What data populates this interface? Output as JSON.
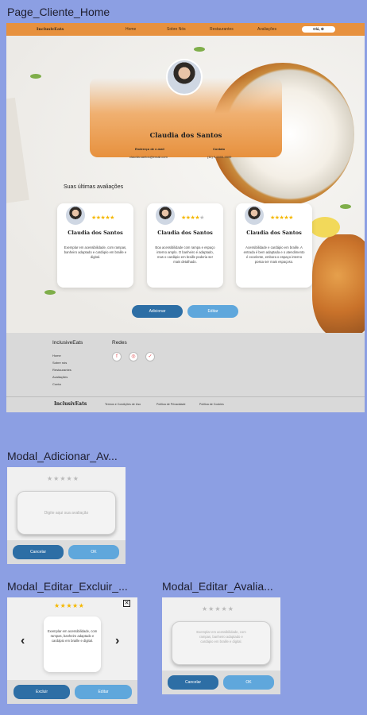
{
  "frames": {
    "home_label": "Page_Cliente_Home",
    "add_label": "Modal_Adicionar_Av...",
    "edit_delete_label": "Modal_Editar_Excluir_...",
    "edit_label": "Modal_Editar_Avalia..."
  },
  "nav": {
    "logo": "InclusivEats",
    "items": [
      "Home",
      "Sobre Nós",
      "Restaurantes",
      "Avaliações"
    ],
    "login_label": "Olá, ⚙"
  },
  "profile": {
    "name": "Claudia dos Santos",
    "address_label": "Endereço de e-mail",
    "address_value": "claudia.santos@email.com",
    "contact_label": "Contato",
    "contact_value": "(11) 9.9999-9999"
  },
  "reviews": {
    "title": "Suas últimas avaliações",
    "cards": [
      {
        "name": "Claudia dos Santos",
        "rating": 5,
        "text": "Exemplar em acessibilidade, com rampas, banheiro adaptado e cardápio em braille e digital."
      },
      {
        "name": "Claudia dos Santos",
        "rating": 4,
        "text": "Boa acessibilidade com rampa e espaço interno amplo. O banheiro é adaptado, mas o cardápio em braille poderia ser mais detalhado."
      },
      {
        "name": "Claudia dos Santos",
        "rating": 5,
        "text": "Acessibilidade e cardápio em braille. A entrada é bem adaptada e o atendimento é excelente, embora o espaço interno possa ser mais espaçoso."
      }
    ]
  },
  "actions": {
    "add_label": "Adicionar",
    "edit_label": "Editar"
  },
  "footer": {
    "brand": "InclusiveEats",
    "links": [
      "Home",
      "Sobre nós",
      "Restaurantes",
      "Avaliações",
      "Conta"
    ],
    "social_title": "Redes",
    "social_icons": [
      "facebook-icon",
      "instagram-icon",
      "twitter-icon"
    ],
    "logo": "InclusivEats",
    "legal": [
      "Termos e Condições de Uso",
      "Política de Privacidade",
      "Política de Cookies"
    ]
  },
  "modal_add": {
    "placeholder": "Digite aqui sua avaliação",
    "cancel_label": "Cancelar",
    "ok_label": "OK"
  },
  "modal_edit_delete": {
    "rating": 5,
    "review_text": "Exemplar em acessibilidade, com rampas, banheiro adaptado e cardápio em braille e digital.",
    "delete_label": "Excluir",
    "edit_label": "Editar"
  },
  "modal_edit": {
    "review_text": "Exemplar em acessibilidade, com rampas, banheiro adaptado e cardápio em braille e digital.",
    "cancel_label": "Cancelar",
    "ok_label": "OK"
  },
  "colors": {
    "nav_orange": "#e7913e",
    "primary_blue": "#2d6ea5",
    "light_blue": "#5fa7dc",
    "star_gold": "#f5b800",
    "canvas": "#8c9fe3"
  }
}
